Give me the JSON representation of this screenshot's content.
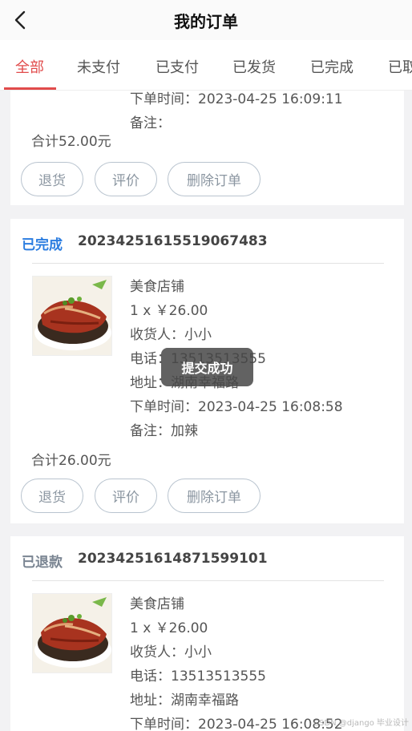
{
  "header": {
    "title": "我的订单"
  },
  "tabs": [
    "全部",
    "未支付",
    "已支付",
    "已发货",
    "已完成",
    "已取"
  ],
  "orders": [
    {
      "store": "",
      "qty_price": "",
      "receiver": "",
      "phone": "",
      "address": "",
      "time": "下单时间：2023-04-25 16:09:11",
      "note": "备注：",
      "total": "合计52.00元",
      "buttons": [
        "退货",
        "评价",
        "删除订单"
      ]
    },
    {
      "status": "已完成",
      "status_color": "#2b7de0",
      "order_no": "20234251615519067483",
      "store": "美食店铺",
      "qty_price": "1 x ￥26.00",
      "receiver": "收货人：小小",
      "phone": "电话：13513513555",
      "address": "地址：湖南幸福路",
      "time": "下单时间：2023-04-25 16:08:58",
      "note": "备注：加辣",
      "total": "合计26.00元",
      "buttons": [
        "退货",
        "评价",
        "删除订单"
      ]
    },
    {
      "status": "已退款",
      "status_color": "#7a8592",
      "order_no": "20234251614871599101",
      "store": "美食店铺",
      "qty_price": "1 x ￥26.00",
      "receiver": "收货人：小小",
      "phone": "电话：13513513555",
      "address": "地址：湖南幸福路",
      "time": "下单时间：2023-04-25 16:08:52"
    }
  ],
  "toast": "提交成功",
  "watermark": "CSDN @django 毕业设计",
  "colors": {
    "accent": "#e14b4b",
    "completed": "#2b7de0",
    "refunded": "#7a8592"
  }
}
